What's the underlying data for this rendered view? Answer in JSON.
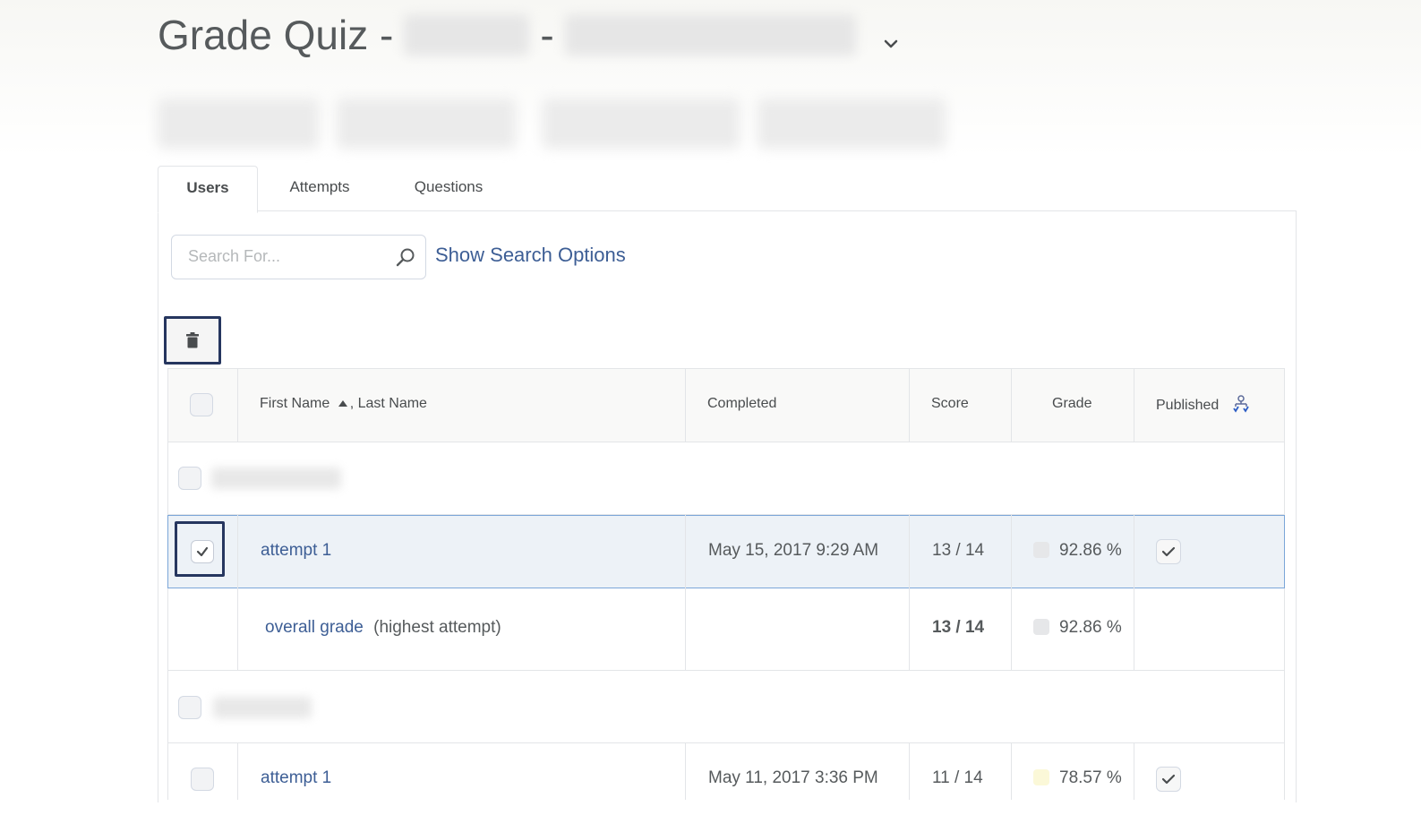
{
  "header": {
    "title_prefix": "Grade Quiz -",
    "dash": "-"
  },
  "tabs": [
    {
      "label": "Users"
    },
    {
      "label": "Attempts"
    },
    {
      "label": "Questions"
    }
  ],
  "search": {
    "placeholder": "Search For...",
    "show_options_label": "Show Search Options"
  },
  "table": {
    "headers": {
      "first_name": "First Name",
      "last_name": ", Last Name",
      "completed": "Completed",
      "score": "Score",
      "grade": "Grade",
      "published": "Published"
    },
    "rows": [
      {
        "attempt_label": "attempt 1",
        "completed": "May 15, 2017 9:29 AM",
        "score": "13 / 14",
        "grade": "92.86 %",
        "selected": true
      },
      {
        "overall_label": "overall grade",
        "overall_note": "(highest attempt)",
        "score": "13 / 14",
        "grade": "92.86 %"
      },
      {
        "attempt_label": "attempt 1",
        "completed": "May 11, 2017 3:36 PM",
        "score": "11 / 14",
        "grade": "78.57 %"
      }
    ]
  },
  "colors": {
    "link": "#3d5e95",
    "highlight_border": "#26365f",
    "selected_row_bg": "#edf2f7",
    "grade_dot_low": "#fbf8d8"
  }
}
